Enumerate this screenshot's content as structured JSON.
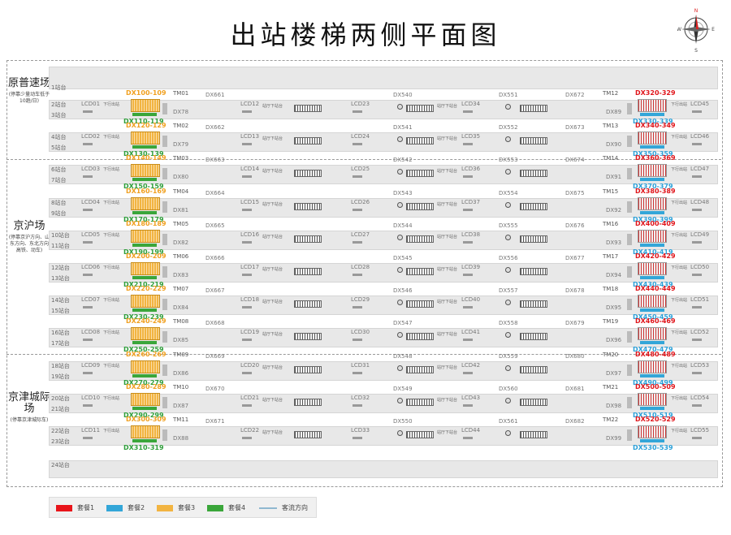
{
  "title": "出站楼梯两侧平面图",
  "compass": {
    "n": "N",
    "s": "S",
    "e": "E",
    "w": "W"
  },
  "zones": [
    {
      "name": "原普速场",
      "note": "(停靠少量动车低于10趟/日)"
    },
    {
      "name": "京沪场",
      "note": "(停靠京沪方向、山东方向、东北方向高铁、动车)"
    },
    {
      "name": "京津城际场",
      "note": "(停靠京津城际车)"
    }
  ],
  "platform_1": "1站台",
  "platform_24": "24站台",
  "down_text": "下行出站",
  "hall_text": "站厅下站台",
  "rows": [
    {
      "p1": "2站台",
      "p2": "3站台",
      "lcd": [
        "LCD01",
        "LCD12",
        "LCD23",
        "LCD34",
        "LCD45"
      ],
      "dx": [
        "DX78",
        "DX661",
        "DX540",
        "DX551",
        "DX672",
        "DX89"
      ],
      "tm_l": "TM01",
      "tm_r": "TM12",
      "o": "DX100-109",
      "g": "DX110-119",
      "r": "DX320-329",
      "b": "DX330-339"
    },
    {
      "p1": "4站台",
      "p2": "5站台",
      "lcd": [
        "LCD02",
        "LCD13",
        "LCD24",
        "LCD35",
        "LCD46"
      ],
      "dx": [
        "DX79",
        "DX662",
        "DX541",
        "DX552",
        "DX673",
        "DX90"
      ],
      "tm_l": "TM02",
      "tm_r": "TM13",
      "o": "DX120-129",
      "g": "DX130-139",
      "r": "DX340-349",
      "b": "DX350-359"
    },
    {
      "p1": "6站台",
      "p2": "7站台",
      "lcd": [
        "LCD03",
        "LCD14",
        "LCD25",
        "LCD36",
        "LCD47"
      ],
      "dx": [
        "DX80",
        "DX663",
        "DX542",
        "DX553",
        "DX674",
        "DX91"
      ],
      "tm_l": "TM03",
      "tm_r": "TM14",
      "o": "DX140-149",
      "g": "DX150-159",
      "r": "DX360-369",
      "b": "DX370-379"
    },
    {
      "p1": "8站台",
      "p2": "9站台",
      "lcd": [
        "LCD04",
        "LCD15",
        "LCD26",
        "LCD37",
        "LCD48"
      ],
      "dx": [
        "DX81",
        "DX664",
        "DX543",
        "DX554",
        "DX675",
        "DX92"
      ],
      "tm_l": "TM04",
      "tm_r": "TM15",
      "o": "DX160-169",
      "g": "DX170-179",
      "r": "DX380-389",
      "b": "DX390-399"
    },
    {
      "p1": "10站台",
      "p2": "11站台",
      "lcd": [
        "LCD05",
        "LCD16",
        "LCD27",
        "LCD38",
        "LCD49"
      ],
      "dx": [
        "DX82",
        "DX665",
        "DX544",
        "DX555",
        "DX676",
        "DX93"
      ],
      "tm_l": "TM05",
      "tm_r": "TM16",
      "o": "DX180-189",
      "g": "DX190-199",
      "r": "DX400-409",
      "b": "DX410-419"
    },
    {
      "p1": "12站台",
      "p2": "13站台",
      "lcd": [
        "LCD06",
        "LCD17",
        "LCD28",
        "LCD39",
        "LCD50"
      ],
      "dx": [
        "DX83",
        "DX666",
        "DX545",
        "DX556",
        "DX677",
        "DX94"
      ],
      "tm_l": "TM06",
      "tm_r": "TM17",
      "o": "DX200-209",
      "g": "DX210-219",
      "r": "DX420-429",
      "b": "DX430-439"
    },
    {
      "p1": "14站台",
      "p2": "15站台",
      "lcd": [
        "LCD07",
        "LCD18",
        "LCD29",
        "LCD40",
        "LCD51"
      ],
      "dx": [
        "DX84",
        "DX667",
        "DX546",
        "DX557",
        "DX678",
        "DX95"
      ],
      "tm_l": "TM07",
      "tm_r": "TM18",
      "o": "DX220-229",
      "g": "DX230-239",
      "r": "DX440-449",
      "b": "DX450-459"
    },
    {
      "p1": "16站台",
      "p2": "17站台",
      "lcd": [
        "LCD08",
        "LCD19",
        "LCD30",
        "LCD41",
        "LCD52"
      ],
      "dx": [
        "DX85",
        "DX668",
        "DX547",
        "DX558",
        "DX679",
        "DX96"
      ],
      "tm_l": "TM08",
      "tm_r": "TM19",
      "o": "DX240-249",
      "g": "DX250-259",
      "r": "DX460-469",
      "b": "DX470-479"
    },
    {
      "p1": "18站台",
      "p2": "19站台",
      "lcd": [
        "LCD09",
        "LCD20",
        "LCD31",
        "LCD42",
        "LCD53"
      ],
      "dx": [
        "DX86",
        "DX669",
        "DX548",
        "DX559",
        "DX680",
        "DX97"
      ],
      "tm_l": "TM09",
      "tm_r": "TM20",
      "o": "DX260-269",
      "g": "DX270-279",
      "r": "DX480-489",
      "b": "DX490-499"
    },
    {
      "p1": "20站台",
      "p2": "21站台",
      "lcd": [
        "LCD10",
        "LCD21",
        "LCD32",
        "LCD43",
        "LCD54"
      ],
      "dx": [
        "DX87",
        "DX670",
        "DX549",
        "DX560",
        "DX681",
        "DX98"
      ],
      "tm_l": "TM10",
      "tm_r": "TM21",
      "o": "DX280-289",
      "g": "DX290-299",
      "r": "DX500-509",
      "b": "DX510-519"
    },
    {
      "p1": "22站台",
      "p2": "23站台",
      "lcd": [
        "LCD11",
        "LCD22",
        "LCD33",
        "LCD44",
        "LCD55"
      ],
      "dx": [
        "DX88",
        "DX671",
        "DX550",
        "DX561",
        "DX682",
        "DX99"
      ],
      "tm_l": "TM11",
      "tm_r": "TM22",
      "o": "DX300-309",
      "g": "DX310-319",
      "r": "DX520-529",
      "b": "DX530-539"
    }
  ],
  "legend": [
    {
      "label": "套餐1",
      "color": "#e8141a"
    },
    {
      "label": "套餐2",
      "color": "#33a6d8"
    },
    {
      "label": "套餐3",
      "color": "#f2b441"
    },
    {
      "label": "套餐4",
      "color": "#3aa63a"
    },
    {
      "label": "客流方向",
      "color": "#8fb8d0"
    }
  ]
}
